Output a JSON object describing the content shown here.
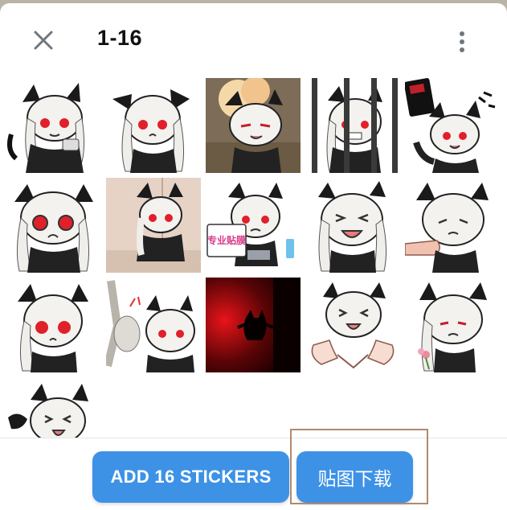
{
  "header": {
    "title": "1-16",
    "close_icon": "close-icon",
    "menu_icon": "more-vertical-icon"
  },
  "stickers": {
    "count": 16,
    "items": [
      "sticker 1",
      "sticker 2",
      "sticker 3",
      "sticker 4",
      "sticker 5",
      "sticker 6",
      "sticker 7",
      "sticker 8",
      "sticker 9",
      "sticker 10",
      "sticker 11",
      "sticker 12",
      "sticker 13",
      "sticker 14",
      "sticker 15",
      "sticker 16"
    ],
    "sign_text": "专业贴膜"
  },
  "footer": {
    "add_label": "ADD 16 STICKERS",
    "download_label": "贴图下载"
  },
  "colors": {
    "accent": "#3d92e6",
    "highlight_border": "#b08a6e"
  }
}
